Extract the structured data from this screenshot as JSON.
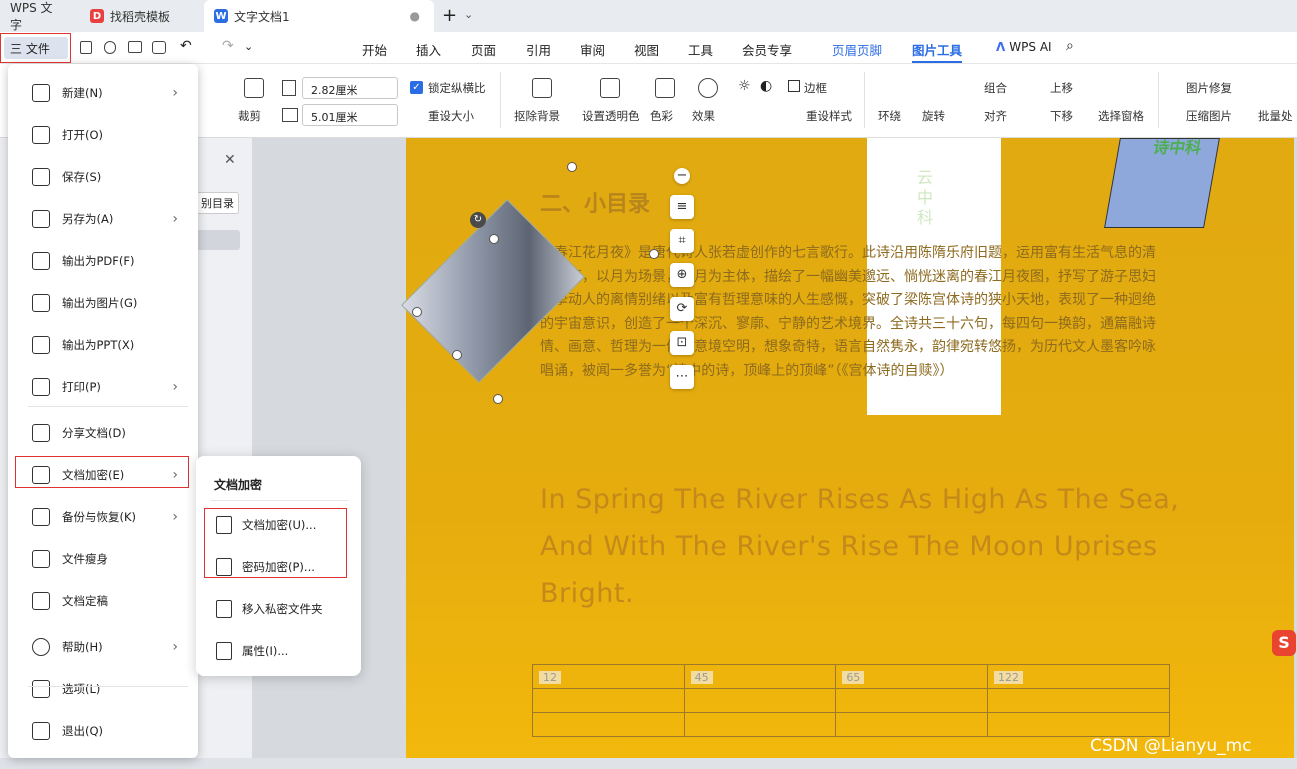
{
  "tabs": [
    {
      "label": "WPS 文字"
    },
    {
      "label": "找稻壳模板"
    },
    {
      "label": "文字文档1"
    }
  ],
  "toolbar": {
    "file_label": "三 文件"
  },
  "menu_tabs": [
    "开始",
    "插入",
    "页面",
    "引用",
    "审阅",
    "视图",
    "工具",
    "会员专享",
    "页眉页脚",
    "图片工具"
  ],
  "wps_ai": "WPS AI",
  "ribbon": {
    "crop": "裁剪",
    "width_value": "2.82厘米",
    "height_value": "5.01厘米",
    "lock_ratio": "锁定纵横比",
    "reset_size": "重设大小",
    "remove_bg": "抠除背景",
    "set_transparent": "设置透明色",
    "color": "色彩",
    "effects": "效果",
    "border": "边框",
    "reset_style": "重设样式",
    "wrap": "环绕",
    "rotate": "旋转",
    "group": "组合",
    "align": "对齐",
    "bring_up": "上移",
    "send_down": "下移",
    "selection_pane": "选择窗格",
    "image_repair": "图片修复",
    "compress": "压缩图片",
    "batch": "批量处"
  },
  "left_pane": {
    "toc_label": "别目录"
  },
  "file_menu": [
    {
      "label": "新建(N)",
      "arrow": true
    },
    {
      "label": "打开(O)",
      "arrow": false
    },
    {
      "label": "保存(S)",
      "arrow": false
    },
    {
      "label": "另存为(A)",
      "arrow": true
    },
    {
      "label": "输出为PDF(F)",
      "arrow": false
    },
    {
      "label": "输出为图片(G)",
      "arrow": false
    },
    {
      "label": "输出为PPT(X)",
      "arrow": false
    },
    {
      "label": "打印(P)",
      "arrow": true
    },
    {
      "label": "分享文档(D)",
      "arrow": false
    },
    {
      "label": "文档加密(E)",
      "arrow": true
    },
    {
      "label": "备份与恢复(K)",
      "arrow": true
    },
    {
      "label": "文件瘦身",
      "arrow": false
    },
    {
      "label": "文档定稿",
      "arrow": false
    },
    {
      "label": "帮助(H)",
      "arrow": true
    },
    {
      "label": "选项(L)",
      "arrow": false
    },
    {
      "label": "退出(Q)",
      "arrow": false
    }
  ],
  "submenu": {
    "title": "文档加密",
    "items": [
      "文档加密(U)...",
      "密码加密(P)...",
      "移入私密文件夹",
      "属性(I)..."
    ]
  },
  "document": {
    "heading": "二、小目录",
    "paragraph": "《春江花月夜》是唐代诗人张若虚创作的七言歌行。此诗沿用陈隋乐府旧题，运用富有生活气息的清丽之笔，以月为场景，以月为主体，描绘了一幅幽美邈远、惝恍迷离的春江月夜图，抒写了游子思妇真挚动人的离情别绪以及富有哲理意味的人生感慨，突破了梁陈宫体诗的狭小天地，表现了一种迥绝的宇宙意识，创造了一个深沉、寥廓、宁静的艺术境界。全诗共三十六句，每四句一换韵，通篇融诗情、画意、哲理为一体，意境空明，想象奇特，语言自然隽永，韵律宛转悠扬，为历代文人墨客吟咏唱诵，被闻一多誉为“诗中的诗，顶峰上的顶峰”（《宫体诗的自赎》）",
    "english_lines": [
      "In Spring The River Rises As High As The Sea,",
      "And With The River's Rise The Moon Uprises",
      "Bright."
    ],
    "vertical_text": "云中科",
    "shape_text": "诗中科",
    "table": [
      [
        "12",
        "45",
        "65",
        "122"
      ],
      [
        "",
        "",
        "",
        ""
      ],
      [
        "",
        "",
        "",
        ""
      ]
    ]
  },
  "watermark": "CSDN @Lianyu_mc"
}
